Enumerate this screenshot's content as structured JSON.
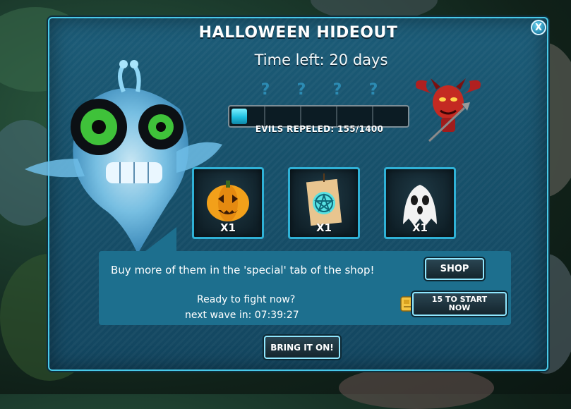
{
  "dialog": {
    "title": "HALLOWEEN HIDEOUT",
    "time_left": "Time left: 20 days",
    "close_label": "X"
  },
  "progress": {
    "milestone_markers": [
      "?",
      "?",
      "?",
      "?"
    ],
    "label": "EVILS REPELED: 155/1400",
    "current": 155,
    "total": 1400
  },
  "rewards": [
    {
      "icon": "jack-o-lantern-icon",
      "count": "X1"
    },
    {
      "icon": "pentagram-scroll-icon",
      "count": "X1"
    },
    {
      "icon": "ghost-sheet-icon",
      "count": "X1"
    }
  ],
  "info": {
    "message": "Buy more of them in the 'special' tab of the shop!",
    "ready_line": "Ready to fight now?",
    "next_wave_line": "next wave in:  07:39:27"
  },
  "buttons": {
    "shop": "SHOP",
    "start_now": "15 TO START NOW",
    "bring_it_on": "BRING IT ON!"
  },
  "colors": {
    "panel": "#17516b",
    "border_accent": "#48c9e8",
    "info_box": "#1d6f8e",
    "progress_fill": "#1fbfe0"
  }
}
